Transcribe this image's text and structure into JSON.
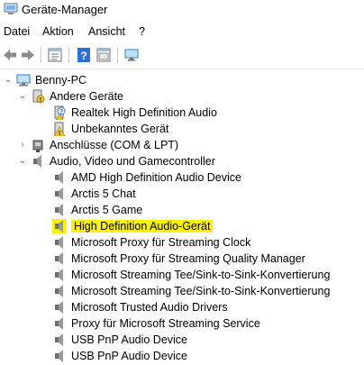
{
  "window": {
    "title": "Geräte-Manager"
  },
  "menu": {
    "items": [
      "Datei",
      "Aktion",
      "Ansicht",
      "?"
    ]
  },
  "toolbar": {
    "buttons": [
      "back-arrow-icon",
      "forward-arrow-icon",
      "properties-icon",
      "help-icon",
      "view-icon",
      "monitor-icon"
    ]
  },
  "tree": {
    "root": "Benny-PC",
    "other_devices": {
      "label": "Andere Geräte",
      "children": [
        "Realtek High Definition Audio",
        "Unbekanntes Gerät"
      ]
    },
    "ports": {
      "label": "Anschlüsse (COM & LPT)"
    },
    "audio": {
      "label": "Audio, Video und Gamecontroller",
      "children": [
        "AMD High Definition Audio Device",
        "Arctis 5 Chat",
        "Arctis 5 Game",
        "High Definition Audio-Gerät",
        "Microsoft Proxy für Streaming Clock",
        "Microsoft Proxy für Streaming Quality Manager",
        "Microsoft Streaming Tee/Sink-to-Sink-Konvertierung",
        "Microsoft Streaming Tee/Sink-to-Sink-Konvertierung",
        "Microsoft Trusted Audio Drivers",
        "Proxy für Microsoft Streaming Service",
        "USB PnP Audio Device",
        "USB PnP Audio Device"
      ],
      "highlighted_index": 3
    }
  },
  "colors": {
    "highlight": "#fff200",
    "accent": "#2f6fd0"
  }
}
